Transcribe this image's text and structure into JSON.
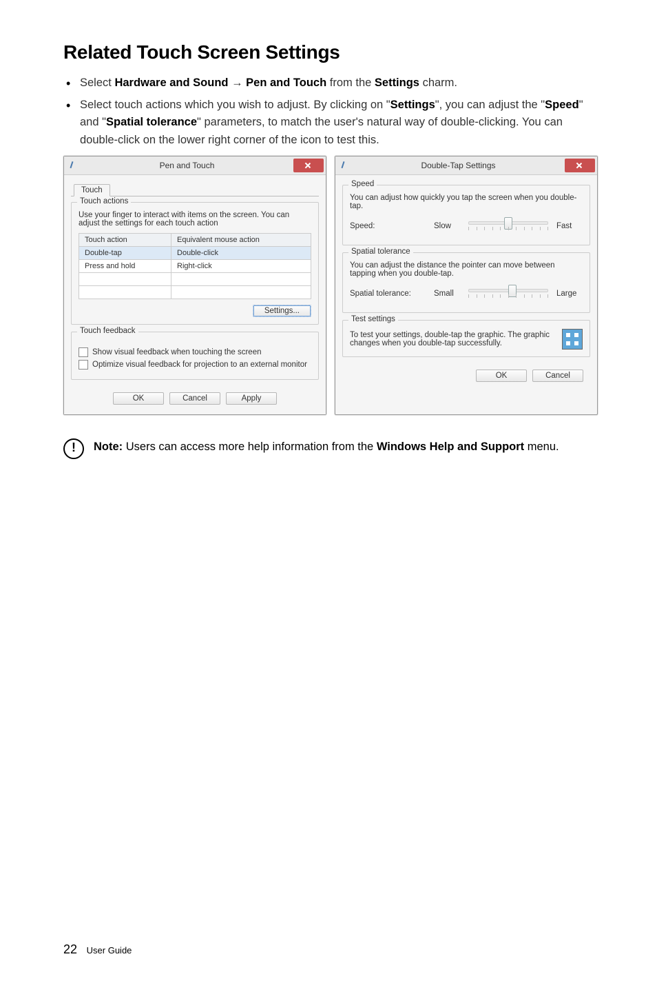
{
  "page": {
    "heading": "Related Touch Screen Settings",
    "bullet1_pre": "Select ",
    "bullet1_hw": "Hardware and Sound",
    "bullet1_arrow": " → ",
    "bullet1_pt": "Pen and Touch",
    "bullet1_mid": " from the ",
    "bullet1_set": "Settings",
    "bullet1_post": " charm.",
    "bullet2_a": "Select touch actions which you wish to adjust. By clicking on \"",
    "bullet2_set": "Settings",
    "bullet2_b": "\", you can adjust the \"",
    "bullet2_speed": "Speed",
    "bullet2_c": "\" and \"",
    "bullet2_spatial": "Spatial tolerance",
    "bullet2_d": "\" parameters, to match the user's natural way of double-clicking. You can double-click on the lower right corner of the icon to test this.",
    "note_prefix": "Note:",
    "note_a": " Users can access more help information from the ",
    "note_whs": "Windows Help and Support",
    "note_b": " menu.",
    "footer_pg": "22",
    "footer_txt": "User Guide"
  },
  "dlg1": {
    "title": "Pen and Touch",
    "tab": "Touch",
    "group_actions": "Touch actions",
    "actions_desc": "Use your finger to interact with items on the screen. You can adjust the settings for each touch action",
    "th1": "Touch action",
    "th2": "Equivalent mouse action",
    "r1c1": "Double-tap",
    "r1c2": "Double-click",
    "r2c1": "Press and hold",
    "r2c2": "Right-click",
    "settings_btn": "Settings...",
    "group_feedback": "Touch feedback",
    "chk1": "Show visual feedback when touching the screen",
    "chk2": "Optimize visual feedback for projection to an external monitor",
    "ok": "OK",
    "cancel": "Cancel",
    "apply": "Apply"
  },
  "dlg2": {
    "title": "Double-Tap Settings",
    "group_speed": "Speed",
    "speed_desc": "You can adjust how quickly you tap the screen when you double-tap.",
    "speed_label": "Speed:",
    "speed_slow": "Slow",
    "speed_fast": "Fast",
    "group_spatial": "Spatial tolerance",
    "spatial_desc": "You can adjust the distance the pointer can move between tapping when you double-tap.",
    "spatial_label": "Spatial tolerance:",
    "spatial_small": "Small",
    "spatial_large": "Large",
    "group_test": "Test settings",
    "test_desc": "To test your settings, double-tap the graphic. The graphic changes when you double-tap successfully.",
    "ok": "OK",
    "cancel": "Cancel"
  },
  "chart_data": null
}
